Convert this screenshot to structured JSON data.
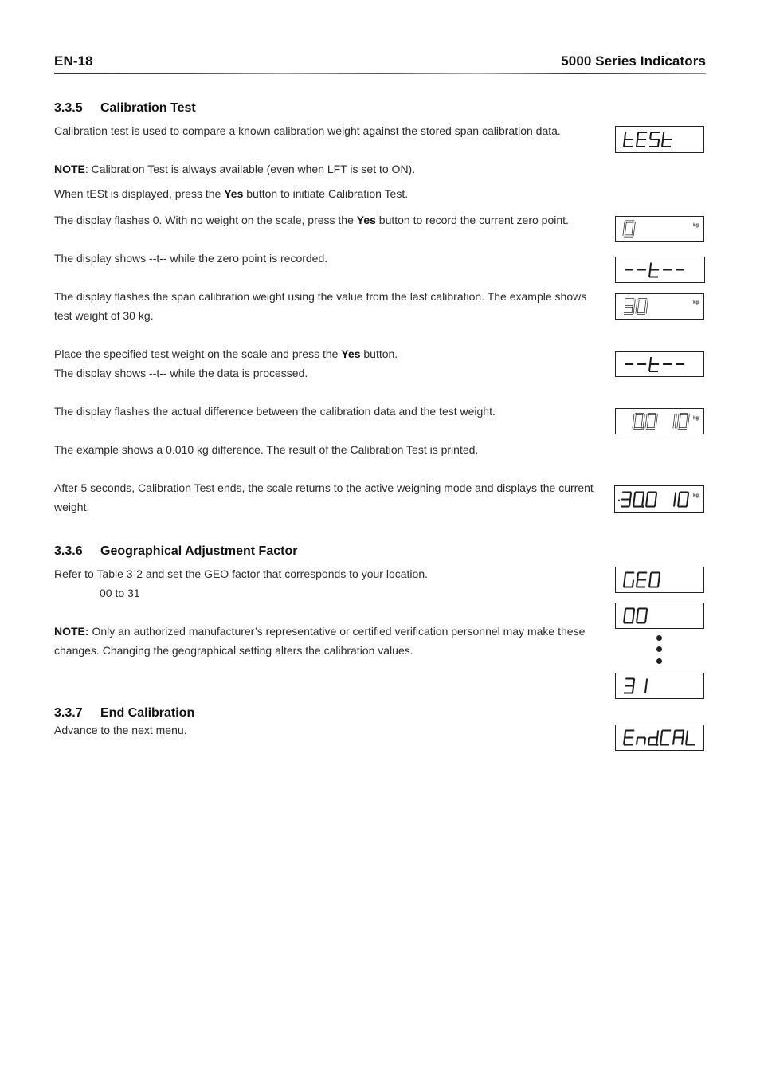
{
  "header": {
    "page_number": "EN-18",
    "doc_title": "5000 Series Indicators"
  },
  "sections": [
    {
      "number": "3.3.5",
      "title": "Calibration Test",
      "paragraphs": {
        "intro": "Calibration test is used to compare a known calibration weight against the stored span calibration data.",
        "note_label": "NOTE",
        "note_text": ":  Calibration Test is always available (even when LFT is set to ON).",
        "when_pre": "When tESt is displayed, press the ",
        "when_bold": "Yes",
        "when_post": " button to initiate Calibration Test.",
        "flash0_pre": "The display flashes 0.  With no weight on the scale, press the ",
        "flash0_bold": "Yes",
        "flash0_post": " button to record the current zero point.",
        "zero_rec": "The display shows --t-- while the zero point is recorded.",
        "span": "The display flashes the span calibration weight using the value from the last calibration. The example shows test weight of 30 kg.",
        "place_pre": "Place the specified test weight on the scale and press the ",
        "place_bold": "Yes",
        "place_post": " button.",
        "processing": "The display shows --t-- while the data is processed.",
        "diff": "The display flashes the actual difference between the calibration data and the test weight.",
        "example": "The example shows a 0.010 kg difference. The result of the Calibration Test is printed.",
        "after": "After 5 seconds, Calibration Test ends, the scale returns to the active weighing mode and displays the current weight."
      }
    },
    {
      "number": "3.3.6",
      "title": "Geographical Adjustment Factor",
      "paragraphs": {
        "refer": "Refer to Table 3-2 and set the GEO factor that corresponds to your location.",
        "range": "00 to 31",
        "note_label": "NOTE:",
        "note_text": " Only an authorized manufacturer’s representative or certified verification personnel may make these changes.  Changing the geographical setting alters the calibration values."
      }
    },
    {
      "number": "3.3.7",
      "title": "End Calibration",
      "paragraphs": {
        "advance": "Advance to the next menu."
      }
    }
  ],
  "displays": [
    {
      "id": "test",
      "text": "tESt",
      "unit": "",
      "flashing": false
    },
    {
      "id": "zero",
      "text": "0",
      "unit": "kg",
      "flashing": true
    },
    {
      "id": "wait1",
      "text": "--t--",
      "unit": "",
      "flashing": false
    },
    {
      "id": "span",
      "text": "30",
      "unit": "kg",
      "flashing": true
    },
    {
      "id": "wait2",
      "text": "--t--",
      "unit": "",
      "flashing": false
    },
    {
      "id": "diff",
      "text": "0.0 10",
      "unit": "kg",
      "flashing": true
    },
    {
      "id": "weight",
      "text": "30.0 10",
      "unit": "kg",
      "flashing": false,
      "indicator": "·"
    },
    {
      "id": "geo",
      "text": "GEO",
      "unit": "",
      "flashing": false
    },
    {
      "id": "geo00",
      "text": "00",
      "unit": "",
      "flashing": false
    },
    {
      "id": "geo31",
      "text": "31",
      "unit": "",
      "flashing": false
    },
    {
      "id": "endcal",
      "text": "End.CAL",
      "unit": "",
      "flashing": false
    }
  ]
}
